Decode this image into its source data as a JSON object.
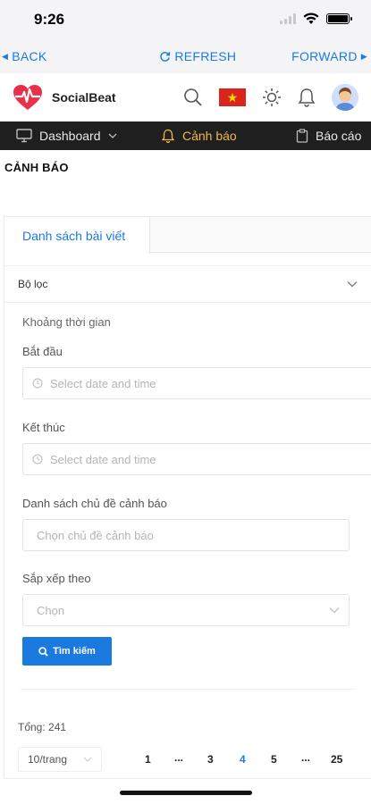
{
  "status_bar": {
    "time": "9:26"
  },
  "browser_bar": {
    "back_label": "BACK",
    "refresh_label": "REFRESH",
    "forward_label": "FORWARD"
  },
  "header": {
    "app_name": "SocialBeat",
    "flag_star": "★"
  },
  "nav": {
    "items": [
      {
        "label": "Dashboard",
        "icon": "monitor-icon"
      },
      {
        "label": "Cảnh báo",
        "icon": "bell-icon",
        "active": true
      },
      {
        "label": "Báo cáo",
        "icon": "clipboard-icon"
      }
    ]
  },
  "page": {
    "title": "CẢNH BÁO"
  },
  "tabs": [
    {
      "label": "Danh sách bài viết"
    }
  ],
  "filter": {
    "title": "Bộ lọc",
    "time_range_label": "Khoảng thời gian",
    "start_label": "Bắt đầu",
    "start_placeholder": "Select date and time",
    "end_label": "Kết thúc",
    "end_placeholder": "Select date and time",
    "topics_label": "Danh sách chủ đề cảnh báo",
    "topics_placeholder": "Chọn chủ đề cảnh báo",
    "sort_label": "Sắp xếp theo",
    "sort_placeholder": "Chọn",
    "search_button": "Tìm kiếm"
  },
  "results": {
    "total_label": "Tổng: 241",
    "page_size": "10/trang",
    "pages": [
      "1",
      "...",
      "3",
      "4",
      "5",
      "...",
      "25"
    ],
    "current_page": "4"
  },
  "colors": {
    "accent": "#1a7ae0",
    "nav_bg": "#1f1f1f",
    "nav_active": "#f2b94a",
    "logo_red": "#e8304b"
  }
}
